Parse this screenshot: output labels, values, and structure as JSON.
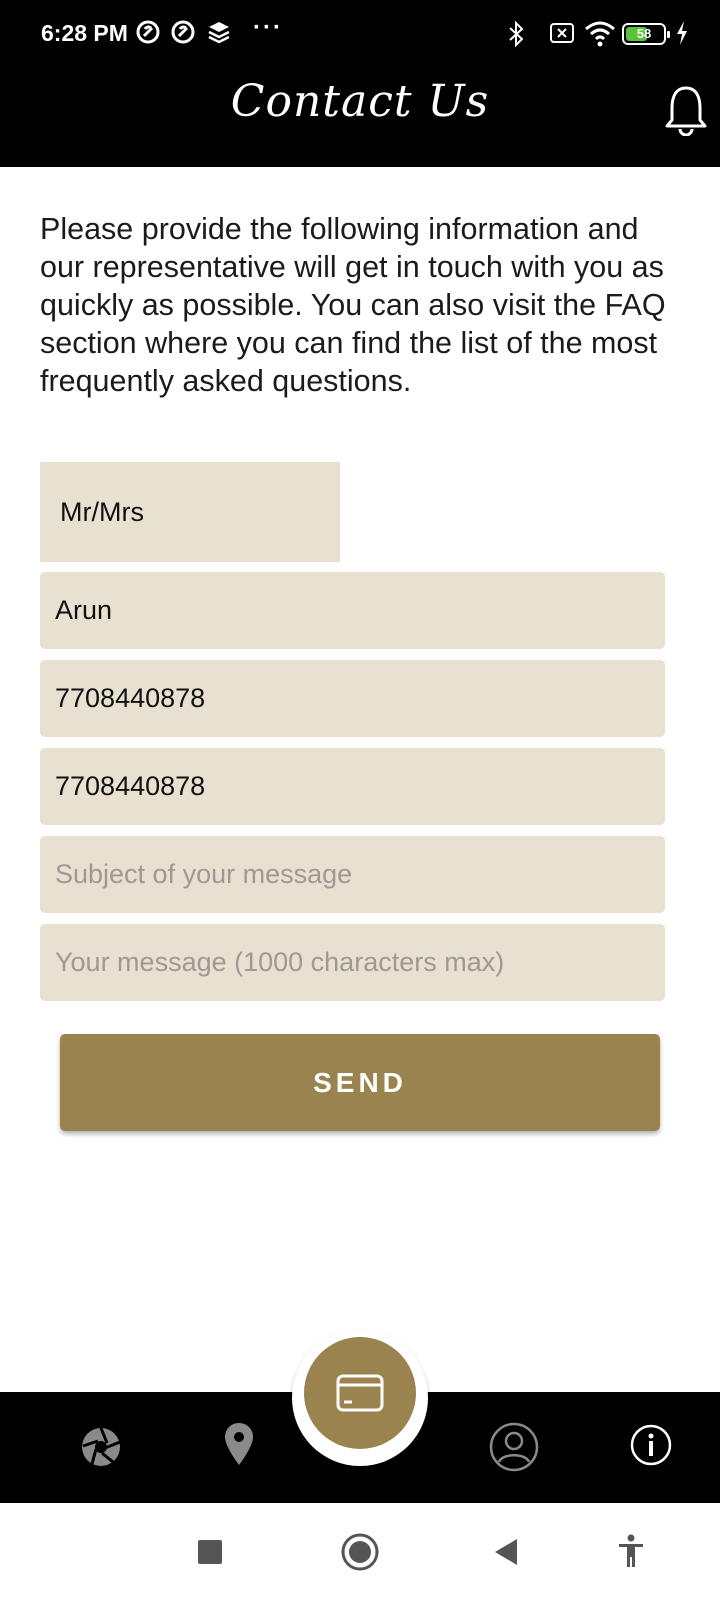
{
  "status_bar": {
    "time": "6:28 PM",
    "overflow": "···",
    "battery_level": "58",
    "battery_fraction": 0.58,
    "icons": [
      "notification-app-icon",
      "notification-app-icon",
      "layers-icon",
      "bluetooth-icon",
      "no-sim-icon",
      "wifi-icon",
      "battery-icon",
      "charging-icon"
    ]
  },
  "header": {
    "title": "Contact Us",
    "icons": [
      "bell-icon"
    ]
  },
  "intro": {
    "text": "Please provide the following information and our representative will get in touch with you as quickly as possible. You can also visit the FAQ section where you can find the list of the most frequently asked questions."
  },
  "form": {
    "title_value": "Mr/Mrs",
    "name_value": "Arun",
    "phone_value": "7708440878",
    "phone_confirm_value": "7708440878",
    "subject_placeholder": "Subject of your message",
    "message_placeholder": "Your message (1000 characters max)",
    "send_label": "SEND"
  },
  "bottom_nav": {
    "items": [
      "camera-shutter-icon",
      "location-pin-icon",
      "card-icon",
      "profile-icon",
      "info-icon"
    ]
  },
  "system_nav": {
    "items": [
      "recents-icon",
      "home-icon",
      "back-icon",
      "accessibility-icon"
    ]
  },
  "colors": {
    "header_bg": "#000000",
    "field_bg": "#e8e1d1",
    "accent": "#9b8350",
    "text": "#1b1b1b",
    "placeholder": "#9e9a93"
  }
}
